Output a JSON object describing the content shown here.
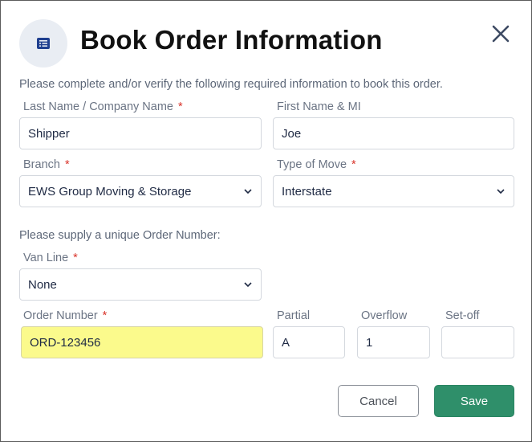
{
  "dialog": {
    "title": "Book Order Information",
    "icon": "form-document-icon",
    "close_icon": "close-icon",
    "instruction": "Please complete and/or verify the following required information to book this order.",
    "supply_text": "Please supply a unique Order Number:"
  },
  "fields": {
    "last_name": {
      "label": "Last Name / Company Name",
      "required": "*",
      "value": "Shipper"
    },
    "first_name": {
      "label": "First Name & MI",
      "value": "Joe"
    },
    "branch": {
      "label": "Branch",
      "required": "*",
      "value": "EWS Group Moving & Storage"
    },
    "type_of_move": {
      "label": "Type of Move",
      "required": "*",
      "value": "Interstate"
    },
    "van_line": {
      "label": "Van Line",
      "required": "*",
      "value": "None"
    },
    "order_number": {
      "label": "Order Number",
      "required": "*",
      "value": "ORD-123456"
    },
    "partial": {
      "label": "Partial",
      "value": "A"
    },
    "overflow": {
      "label": "Overflow",
      "value": "1"
    },
    "setoff": {
      "label": "Set-off",
      "value": ""
    }
  },
  "buttons": {
    "cancel": "Cancel",
    "save": "Save"
  },
  "colors": {
    "primary_button": "#2f8f6a",
    "required_marker": "#d9342b",
    "highlight_field": "#fbfa8c",
    "icon_accent": "#1f3f8f"
  }
}
